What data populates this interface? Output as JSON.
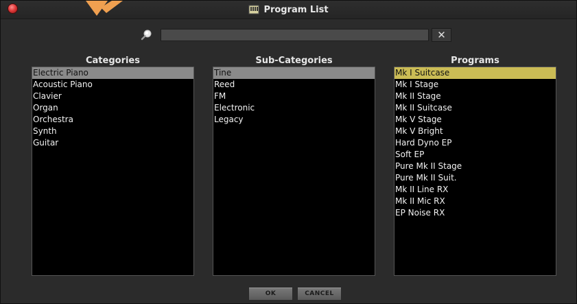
{
  "window": {
    "title": "Program List"
  },
  "search": {
    "value": "",
    "clear_label": "✕"
  },
  "columns": {
    "categories": {
      "header": "Categories",
      "items": [
        "Electric Piano",
        "Acoustic Piano",
        "Clavier",
        "Organ",
        "Orchestra",
        "Synth",
        "Guitar"
      ],
      "selected_index": 0
    },
    "subcategories": {
      "header": "Sub-Categories",
      "items": [
        "Tine",
        "Reed",
        "FM",
        "Electronic",
        "Legacy"
      ],
      "selected_index": 0
    },
    "programs": {
      "header": "Programs",
      "items": [
        "Mk I Suitcase",
        "Mk I Stage",
        "Mk II Stage",
        "Mk II Suitcase",
        "Mk V Stage",
        "Mk V Bright",
        "Hard Dyno EP",
        "Soft EP",
        "Pure Mk II Stage",
        "Pure Mk II Suit.",
        "Mk II Line RX",
        "Mk II Mic RX",
        "EP Noise RX"
      ],
      "selected_index": 0
    }
  },
  "buttons": {
    "ok_label": "OK",
    "cancel_label": "CANCEL"
  },
  "colors": {
    "highlight_grey": "#8a8a8a",
    "highlight_yellow": "#cbbc55",
    "arrow": "#f0a050"
  },
  "icons": [
    "close-icon",
    "program-list-icon",
    "search-icon",
    "clear-icon",
    "annotation-arrow"
  ]
}
